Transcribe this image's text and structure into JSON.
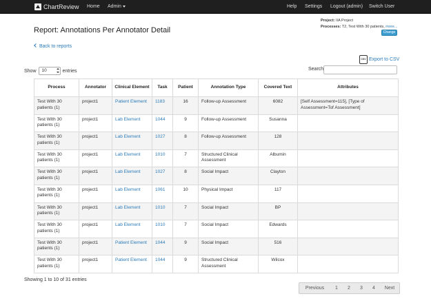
{
  "nav": {
    "brand": "ChartReview",
    "home": "Home",
    "admin": "Admin",
    "help": "Help",
    "settings": "Settings",
    "logout": "Logout (admin)",
    "switch_user": "Switch User"
  },
  "page": {
    "title": "Report: Annotations Per Annotator Detail",
    "project_label": "Project:",
    "project_value": "IIA Project",
    "processes_label": "Processes:",
    "processes_value": "T2, Test With 30 patients,",
    "more_link": "more...",
    "change_button": "Change",
    "back_link": "Back to reports",
    "export_link": "Export to CSV"
  },
  "table_controls": {
    "show_label": "Show",
    "entries_value": "10",
    "entries_label": "entries",
    "search_label": "Search:",
    "search_value": ""
  },
  "table": {
    "columns": [
      "Process",
      "Annotator",
      "Clinical Element",
      "Task",
      "Patient",
      "Annotation Type",
      "Covered Text",
      "Attributes"
    ],
    "rows": [
      {
        "process": "Test With 30 patients (1)",
        "annotator": "project1",
        "element": "Patient Element",
        "task": "1183",
        "patient": "16",
        "type": "Follow-up Assessment",
        "text": "6082",
        "attrs": "[Self Assessment=115], [Type of Assessment=Tof Assessment]"
      },
      {
        "process": "Test With 30 patients (1)",
        "annotator": "project1",
        "element": "Lab Element",
        "task": "1044",
        "patient": "9",
        "type": "Follow-up Assessment",
        "text": "Susanna",
        "attrs": ""
      },
      {
        "process": "Test With 30 patients (1)",
        "annotator": "project1",
        "element": "Lab Element",
        "task": "1027",
        "patient": "8",
        "type": "Follow-up Assessment",
        "text": "128",
        "attrs": ""
      },
      {
        "process": "Test With 30 patients (1)",
        "annotator": "project1",
        "element": "Lab Element",
        "task": "1010",
        "patient": "7",
        "type": "Structured Clinical Assessment",
        "text": "Albumin",
        "attrs": ""
      },
      {
        "process": "Test With 30 patients (1)",
        "annotator": "project1",
        "element": "Lab Element",
        "task": "1027",
        "patient": "8",
        "type": "Social Impact",
        "text": "Clayton",
        "attrs": ""
      },
      {
        "process": "Test With 30 patients (1)",
        "annotator": "project1",
        "element": "Lab Element",
        "task": "1061",
        "patient": "10",
        "type": "Physical Impact",
        "text": "117",
        "attrs": ""
      },
      {
        "process": "Test With 30 patients (1)",
        "annotator": "project1",
        "element": "Lab Element",
        "task": "1010",
        "patient": "7",
        "type": "Social Impact",
        "text": "BP",
        "attrs": ""
      },
      {
        "process": "Test With 30 patients (1)",
        "annotator": "project1",
        "element": "Lab Element",
        "task": "1010",
        "patient": "7",
        "type": "Social Impact",
        "text": "Edwards",
        "attrs": ""
      },
      {
        "process": "Test With 30 patients (1)",
        "annotator": "project1",
        "element": "Patient Element",
        "task": "1044",
        "patient": "9",
        "type": "Social Impact",
        "text": "516",
        "attrs": ""
      },
      {
        "process": "Test With 30 patients (1)",
        "annotator": "project1",
        "element": "Patient Element",
        "task": "1044",
        "patient": "9",
        "type": "Structured Clinical Assessment",
        "text": "Wilcox",
        "attrs": ""
      }
    ]
  },
  "footer": {
    "info": "Showing 1 to 10 of 31 entries",
    "pager": {
      "previous": "Previous",
      "pages": [
        "1",
        "2",
        "3",
        "4"
      ],
      "next": "Next"
    }
  }
}
